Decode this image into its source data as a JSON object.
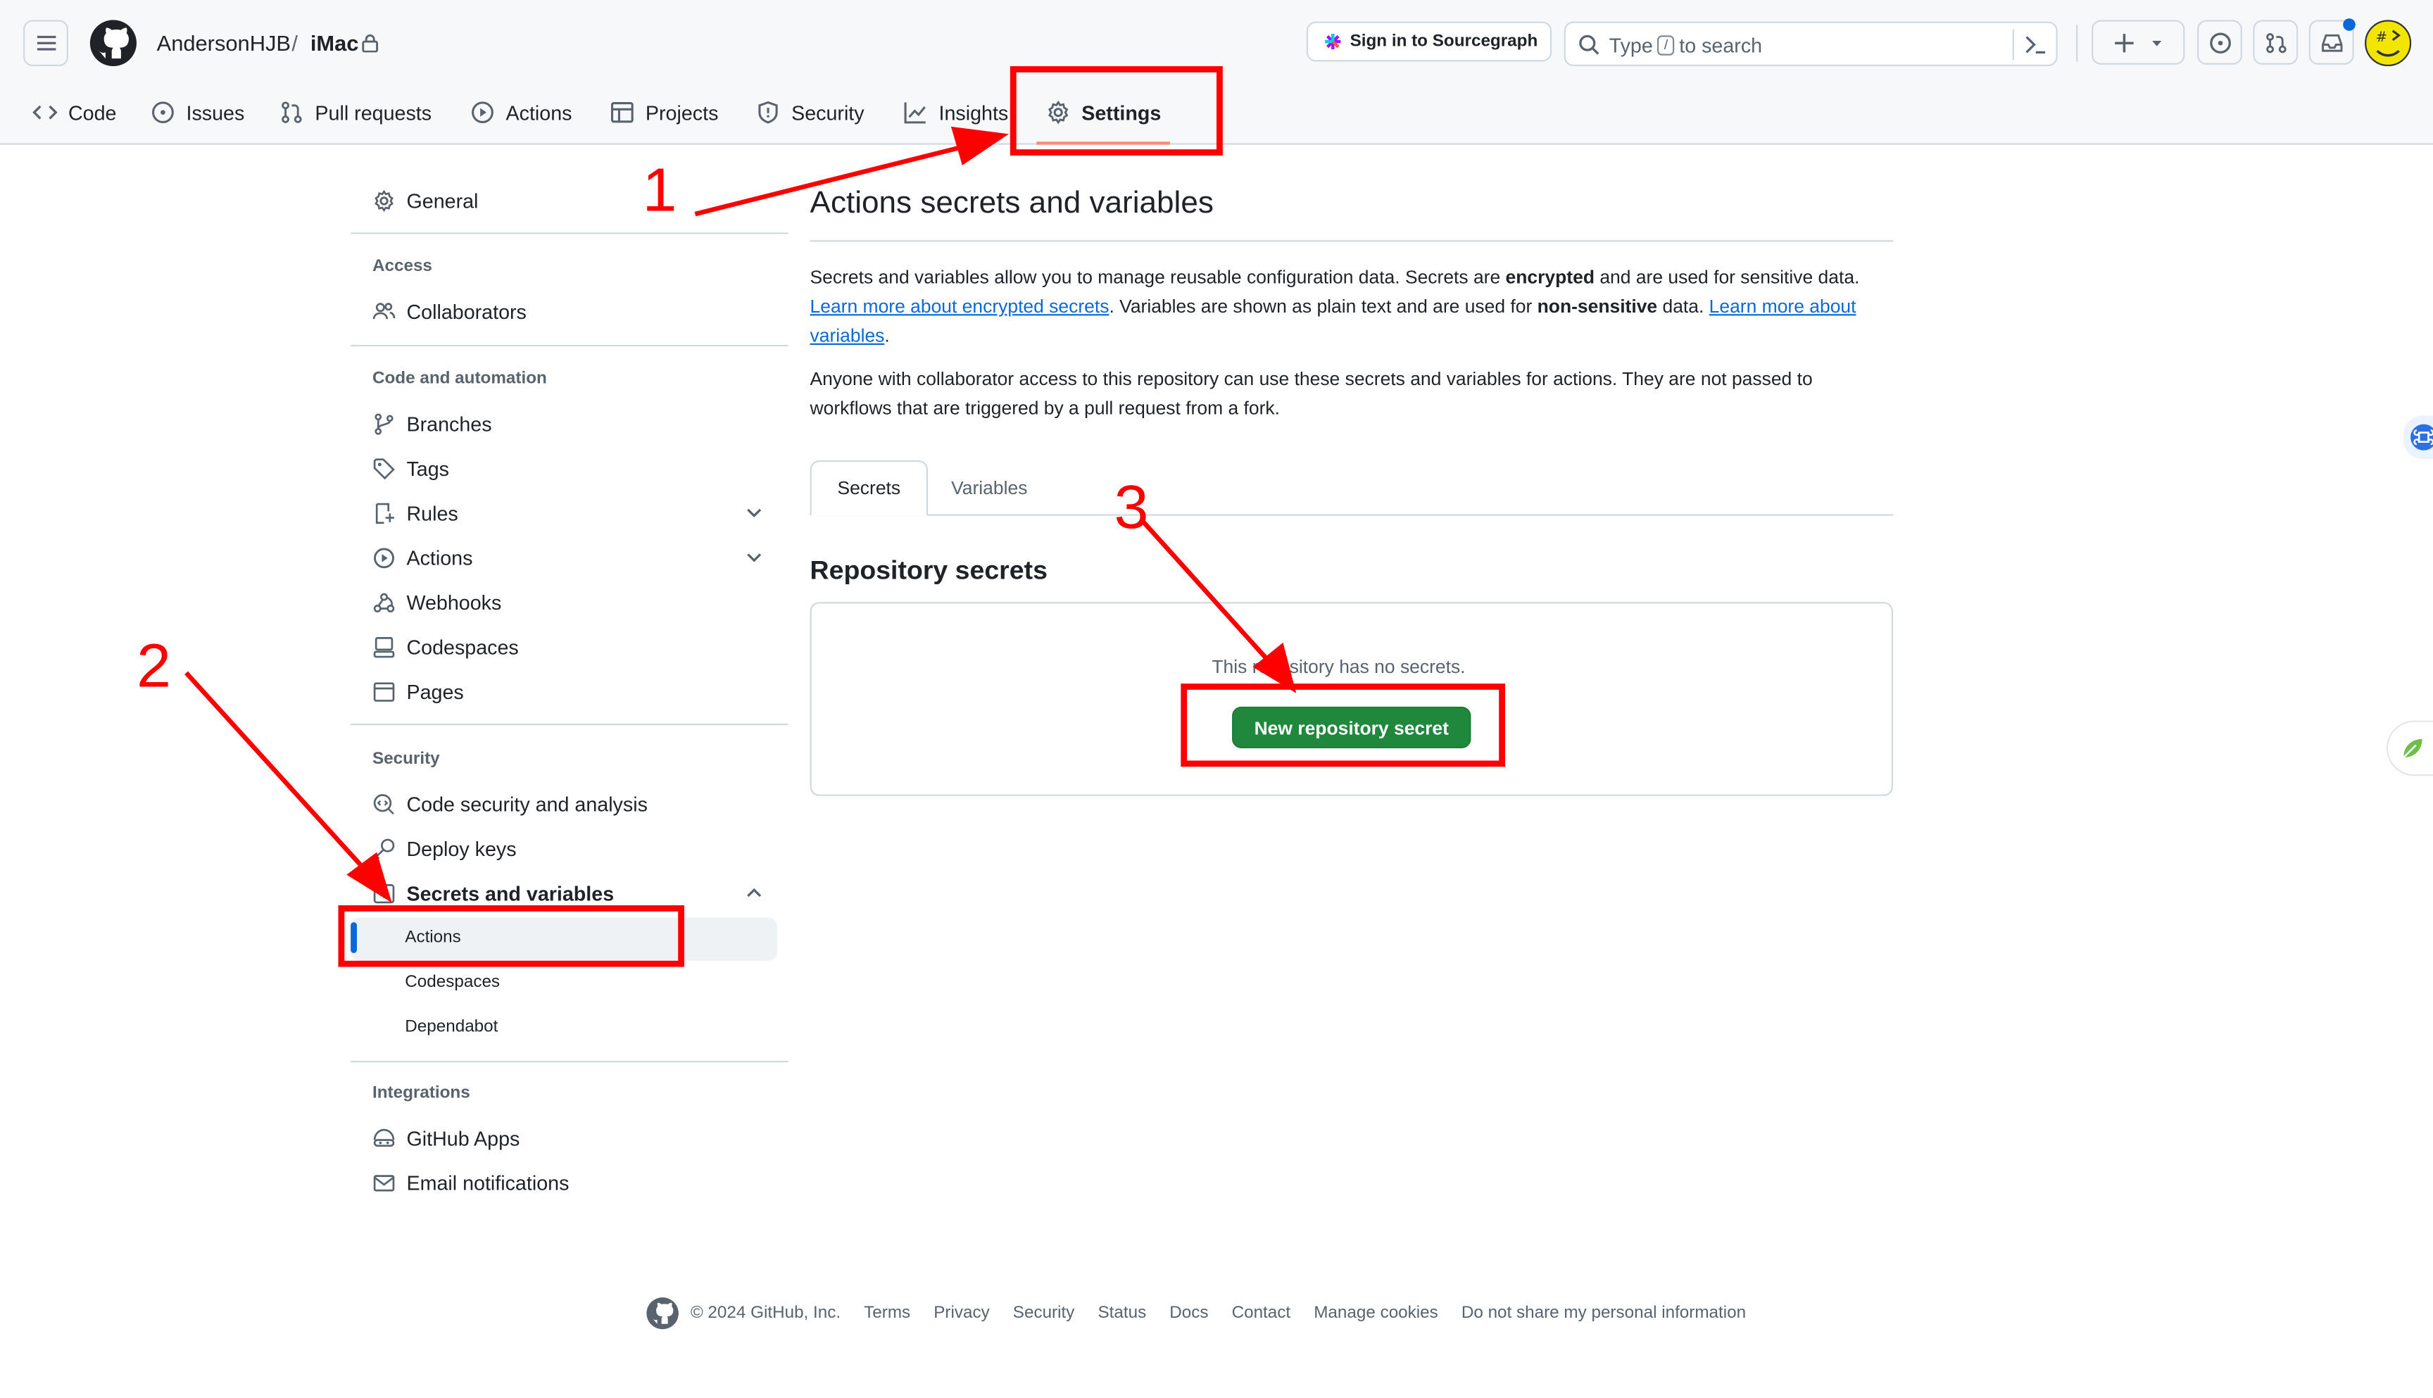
{
  "header": {
    "repo_owner": "AndersonHJB",
    "repo_separator": "/",
    "repo_name": "iMac",
    "sourcegraph_label": "Sign in to Sourcegraph",
    "search_prefix": "Type",
    "search_slash": "/",
    "search_suffix": "to search",
    "plus_icon": "plus-icon",
    "notification_dot_color": "#0969da"
  },
  "nav": {
    "tabs": [
      {
        "label": "Code",
        "icon": "code-icon"
      },
      {
        "label": "Issues",
        "icon": "issue-icon"
      },
      {
        "label": "Pull requests",
        "icon": "pull-request-icon"
      },
      {
        "label": "Actions",
        "icon": "play-icon"
      },
      {
        "label": "Projects",
        "icon": "table-icon"
      },
      {
        "label": "Security",
        "icon": "shield-icon"
      },
      {
        "label": "Insights",
        "icon": "graph-icon"
      },
      {
        "label": "Settings",
        "icon": "gear-icon"
      }
    ],
    "active_tab": "Settings",
    "active_underline_color": "#fd8c73"
  },
  "sidebar": {
    "general": "General",
    "access_heading": "Access",
    "collaborators": "Collaborators",
    "code_heading": "Code and automation",
    "branches": "Branches",
    "tags": "Tags",
    "rules": "Rules",
    "actions": "Actions",
    "webhooks": "Webhooks",
    "codespaces": "Codespaces",
    "pages": "Pages",
    "security_heading": "Security",
    "code_security": "Code security and analysis",
    "deploy_keys": "Deploy keys",
    "secrets_vars": "Secrets and variables",
    "sub_actions": "Actions",
    "sub_codespaces": "Codespaces",
    "sub_dependabot": "Dependabot",
    "integrations_heading": "Integrations",
    "github_apps": "GitHub Apps",
    "email_notifications": "Email notifications"
  },
  "main": {
    "title": "Actions secrets and variables",
    "p1_a": "Secrets and variables allow you to manage reusable configuration data. Secrets are ",
    "p1_b": "encrypted",
    "p1_c": " and are used for sensitive data. ",
    "p1_link1": "Learn more about encrypted secrets",
    "p1_d": ". Variables are shown as plain text and are used for ",
    "p1_e": "non-sensitive",
    "p1_f": " data. ",
    "p1_link2": "Learn more about variables",
    "p1_g": ".",
    "p2": "Anyone with collaborator access to this repository can use these secrets and variables for actions. They are not passed to workflows that are triggered by a pull request from a fork.",
    "tab_secrets": "Secrets",
    "tab_variables": "Variables",
    "section_title": "Repository secrets",
    "empty_message": "This repository has no secrets.",
    "new_secret_button": "New repository secret",
    "button_color": "#1f883d",
    "link_color": "#0969da"
  },
  "annotations": {
    "step1": "1",
    "step2": "2",
    "step3": "3",
    "color": "#ff0000"
  },
  "footer": {
    "copyright": "© 2024 GitHub, Inc.",
    "links": [
      "Terms",
      "Privacy",
      "Security",
      "Status",
      "Docs",
      "Contact",
      "Manage cookies",
      "Do not share my personal information"
    ]
  }
}
